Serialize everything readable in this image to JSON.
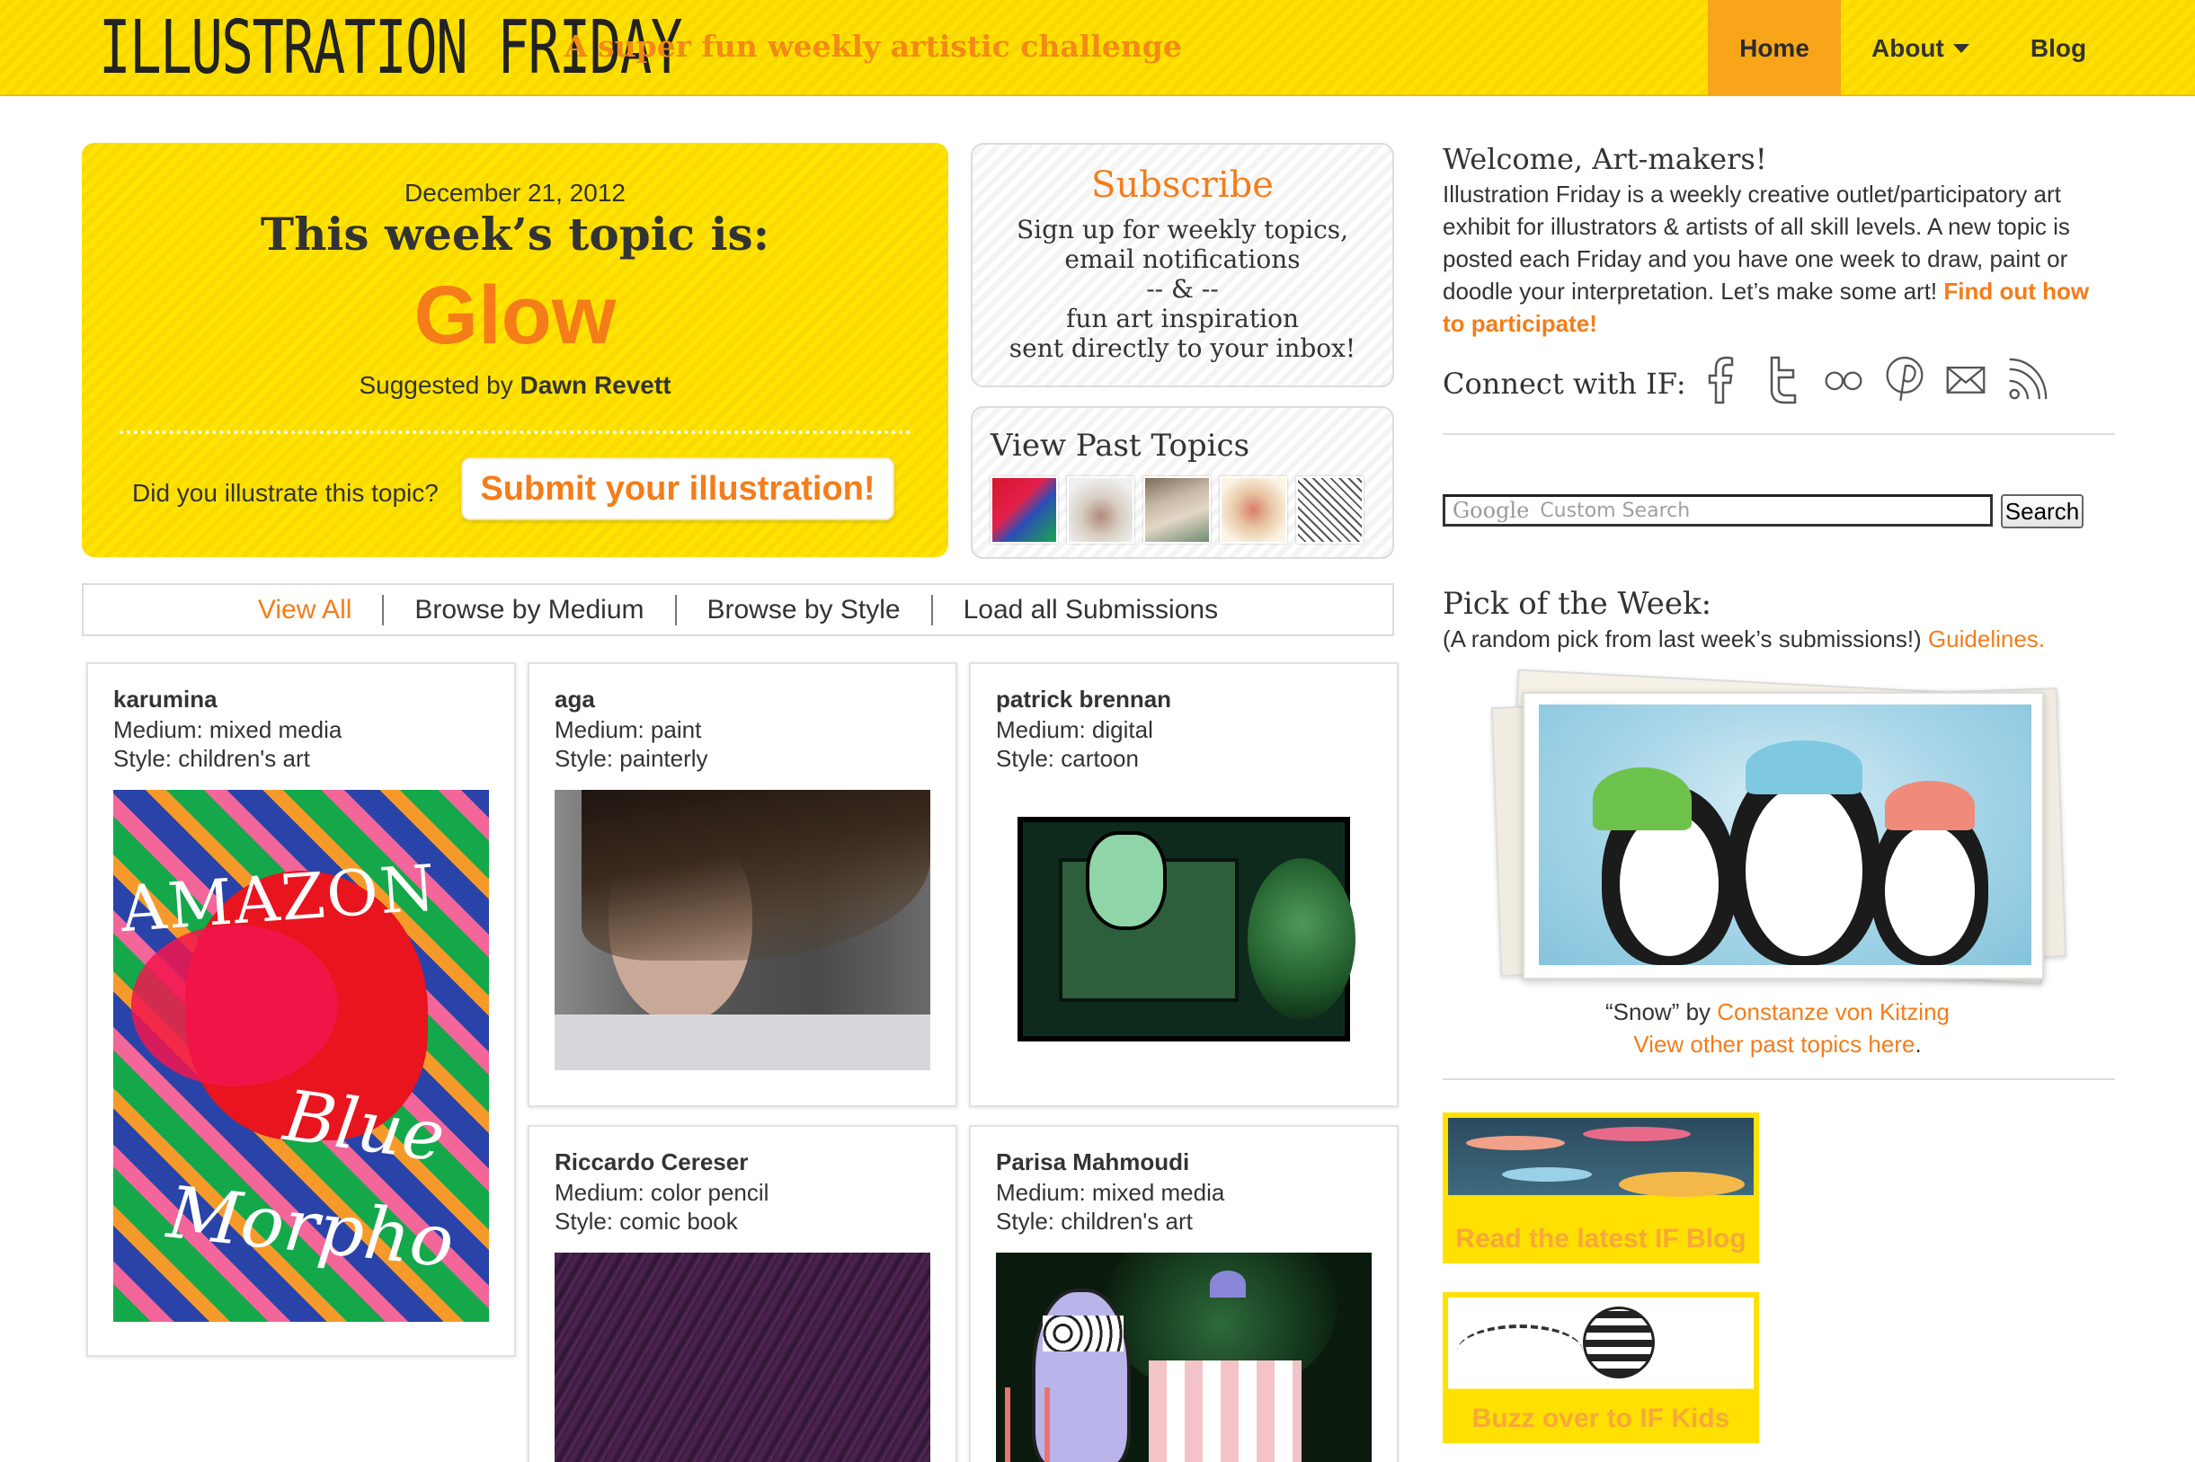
{
  "header": {
    "logo": "ILLUSTRATION FRIDAY",
    "tagline": "A super fun weekly artistic challenge",
    "nav": [
      {
        "label": "Home",
        "active": true
      },
      {
        "label": "About",
        "has_dropdown": true
      },
      {
        "label": "Blog"
      }
    ],
    "colors": {
      "header_bg": "#ffe000",
      "active_nav": "#f9a51a",
      "accent": "#f47d1a"
    }
  },
  "topic": {
    "date": "December 21, 2012",
    "heading": "This week’s topic is:",
    "word": "Glow",
    "suggested_prefix": "Suggested by",
    "suggested_by": "Dawn Revett",
    "question": "Did you illustrate this topic?",
    "submit_label": "Submit your illustration!"
  },
  "subscribe": {
    "title": "Subscribe",
    "line1": "Sign up for weekly topics,",
    "line2": "email notifications",
    "line3": "-- & --",
    "line4": "fun art inspiration",
    "line5": "sent directly to your inbox!"
  },
  "past_topics": {
    "title": "View Past Topics"
  },
  "filters": [
    {
      "label": "View All",
      "active": true
    },
    {
      "label": "Browse by Medium"
    },
    {
      "label": "Browse by Style"
    },
    {
      "label": "Load all Submissions"
    }
  ],
  "submissions": [
    {
      "name": "karumina",
      "medium": "Medium: mixed media",
      "style": "Style: children's art",
      "art_text": [
        "AMAZON",
        "Blue",
        "Morpho"
      ]
    },
    {
      "name": "aga",
      "medium": "Medium: paint",
      "style": "Style: painterly"
    },
    {
      "name": "patrick brennan",
      "medium": "Medium: digital",
      "style": "Style: cartoon"
    },
    {
      "name": "Riccardo Cereser",
      "medium": "Medium: color pencil",
      "style": "Style: comic book"
    },
    {
      "name": "Parisa Mahmoudi",
      "medium": "Medium: mixed media",
      "style": "Style: children's art"
    }
  ],
  "sidebar": {
    "welcome_title": "Welcome, Art-makers!",
    "welcome_text": "Illustration Friday is a weekly creative outlet/participatory art exhibit for illustrators & artists of all skill levels. A new topic is posted each Friday and you have one week to draw, paint or doodle your interpretation. Let’s make some art!",
    "welcome_link": "Find out how to participate!",
    "connect_label": "Connect with IF:",
    "social_icons": [
      "facebook-icon",
      "twitter-icon",
      "flickr-icon",
      "pinterest-icon",
      "email-icon",
      "rss-icon"
    ],
    "search": {
      "placeholder": "Custom Search",
      "google": "Google",
      "button": "Search"
    },
    "pick_title": "Pick of the Week:",
    "pick_sub": "(A random pick from last week’s submissions!)",
    "pick_link": "Guidelines.",
    "caption_title": "“Snow” by",
    "caption_artist": "Constanze von Kitzing",
    "caption_link": "View other past topics here",
    "caption_period": ".",
    "banner_blog": "Read the latest IF Blog",
    "banner_kids": "Buzz over to IF Kids"
  }
}
